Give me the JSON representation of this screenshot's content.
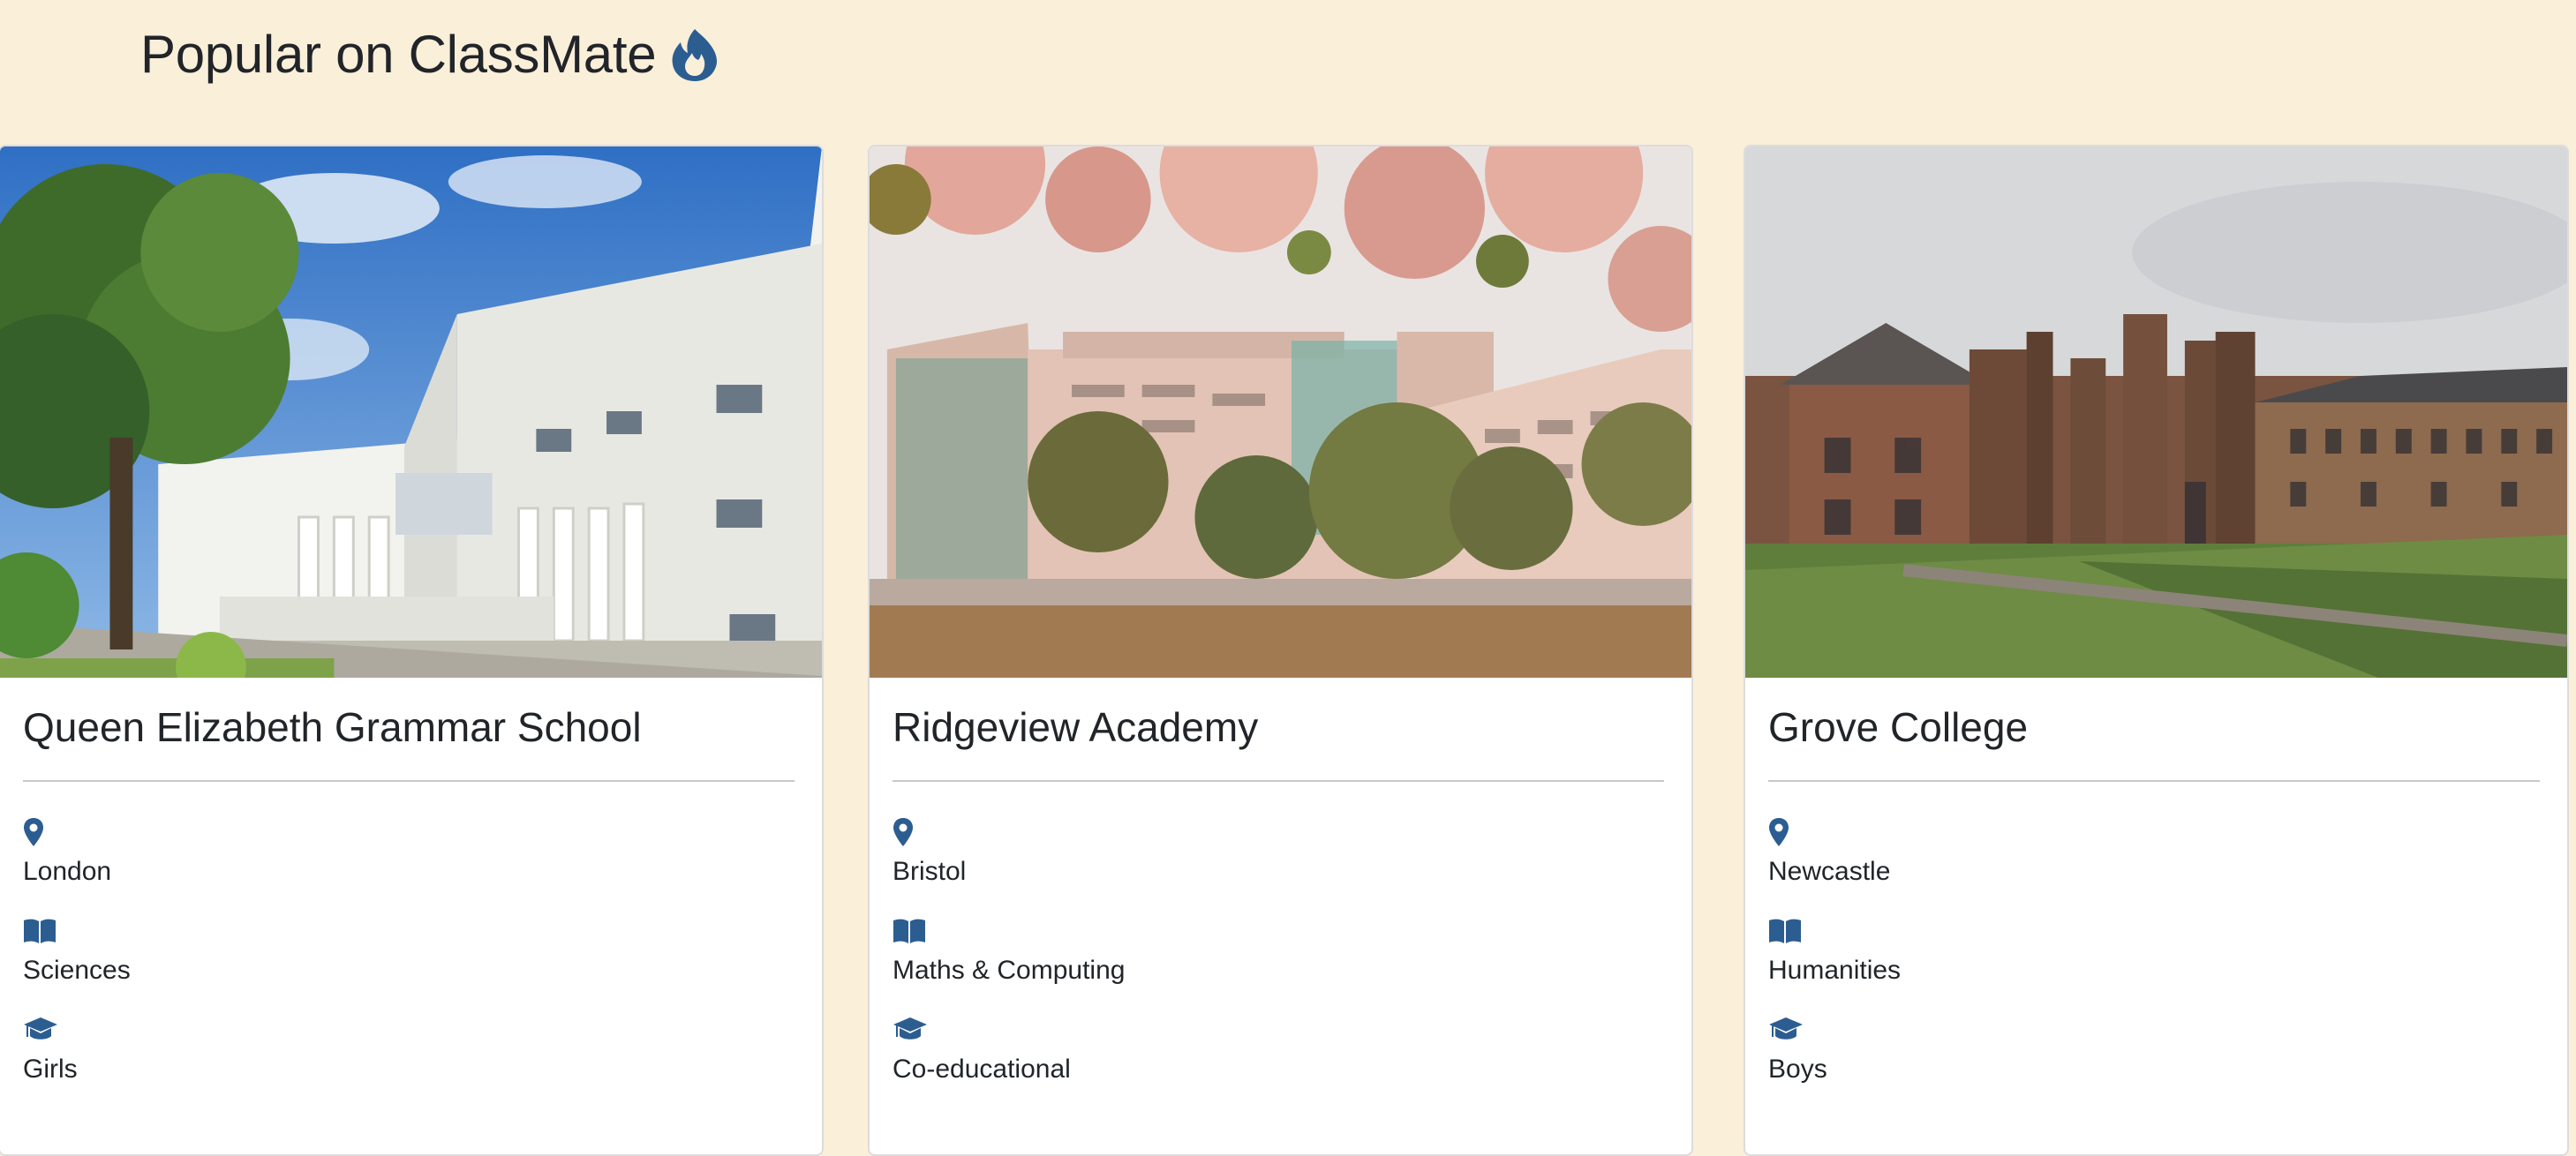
{
  "page": {
    "heading": "Popular on ClassMate",
    "heading_icon": "flame-icon"
  },
  "theme": {
    "background": "#faefd9",
    "card_background": "#ffffff",
    "icon_color": "#2c5d91",
    "text_color": "#212529"
  },
  "cards": [
    {
      "name": "Queen Elizabeth Grammar School",
      "photo": "white-school-building-with-trees-photo",
      "location": "London",
      "subject": "Sciences",
      "gender": "Girls"
    },
    {
      "name": "Ridgeview Academy",
      "photo": "pink-campus-buildings-under-blossom-photo",
      "location": "Bristol",
      "subject": "Maths & Computing",
      "gender": "Co-educational"
    },
    {
      "name": "Grove College",
      "photo": "historic-brick-college-quad-photo",
      "location": "Newcastle",
      "subject": "Humanities",
      "gender": "Boys"
    }
  ],
  "icons": {
    "location": "map-pin-icon",
    "subject": "open-book-icon",
    "gender": "graduation-cap-icon"
  }
}
